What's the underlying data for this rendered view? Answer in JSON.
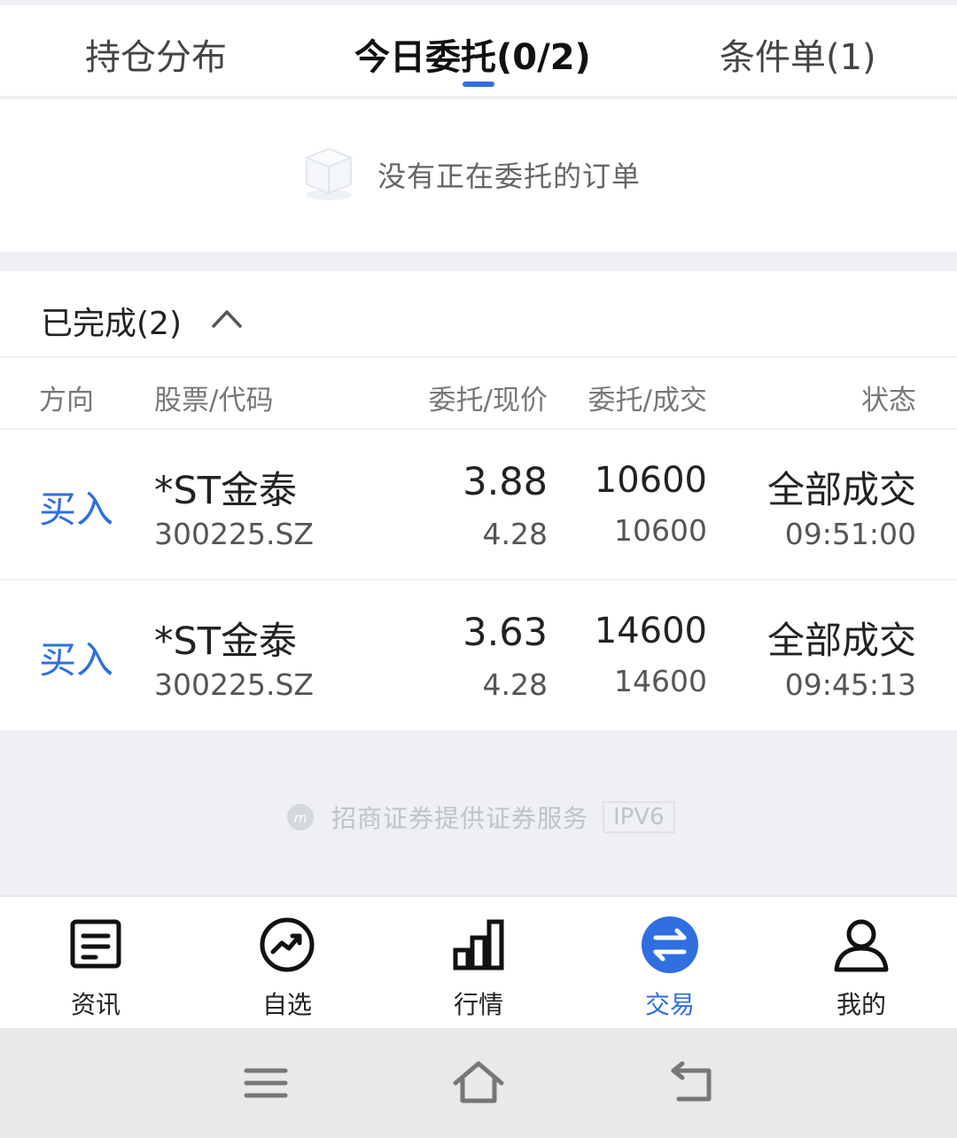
{
  "tabs": [
    {
      "label": "持仓分布"
    },
    {
      "label": "今日委托(0/2)",
      "active": true
    },
    {
      "label": "条件单(1)"
    }
  ],
  "empty": {
    "text": "没有正在委托的订单",
    "icon": "empty-box-icon"
  },
  "completed": {
    "title": "已完成(2)",
    "expanded": true,
    "headers": {
      "direction": "方向",
      "stock": "股票/代码",
      "price": "委托/现价",
      "qty": "委托/成交",
      "status": "状态"
    },
    "rows": [
      {
        "direction": "买入",
        "name": "*ST金泰",
        "code": "300225.SZ",
        "order_price": "3.88",
        "current_price": "4.28",
        "order_qty": "10600",
        "filled_qty": "10600",
        "status": "全部成交",
        "time": "09:51:00"
      },
      {
        "direction": "买入",
        "name": "*ST金泰",
        "code": "300225.SZ",
        "order_price": "3.63",
        "current_price": "4.28",
        "order_qty": "14600",
        "filled_qty": "14600",
        "status": "全部成交",
        "time": "09:45:13"
      }
    ]
  },
  "footer": {
    "provider": "招商证券提供证券服务",
    "badge": "IPV6"
  },
  "bottom_nav": [
    {
      "label": "资讯",
      "icon": "news-icon"
    },
    {
      "label": "自选",
      "icon": "watchlist-trend-icon"
    },
    {
      "label": "行情",
      "icon": "market-bars-icon"
    },
    {
      "label": "交易",
      "icon": "trade-exchange-icon",
      "active": true
    },
    {
      "label": "我的",
      "icon": "profile-icon"
    }
  ],
  "system_nav": [
    {
      "icon": "menu-icon"
    },
    {
      "icon": "home-icon"
    },
    {
      "icon": "back-icon"
    }
  ],
  "colors": {
    "accent": "#2f6fe0",
    "background": "#eef0f4"
  }
}
